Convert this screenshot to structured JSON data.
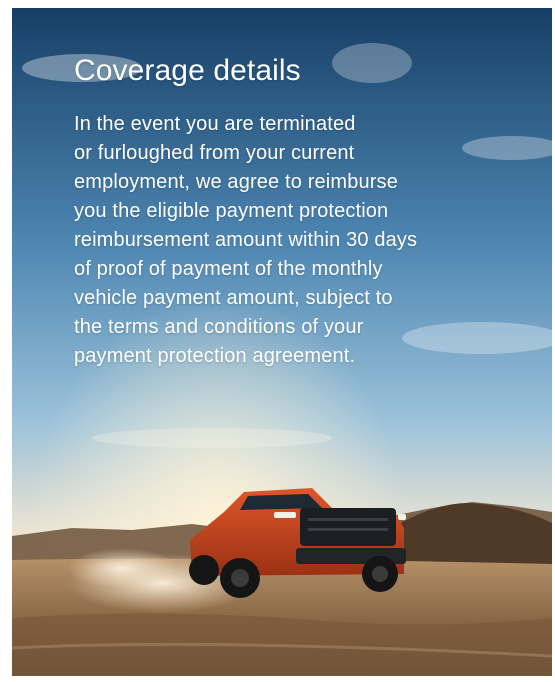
{
  "coverage": {
    "title": "Coverage details",
    "body_lines": [
      "In the event you are terminated",
      "or furloughed from your current",
      "employment, we agree to reimburse",
      "you the eligible payment protection",
      "reimbursement amount within 30 days",
      "of proof of payment of the monthly",
      "vehicle payment amount, subject to",
      "the terms and conditions of your",
      "payment protection agreement."
    ]
  },
  "colors": {
    "text": "#ffffff",
    "sky_top": "#1d4f7c",
    "sky_mid": "#6fa2c6",
    "horizon": "#f3e1c2",
    "ground": "#8a6846",
    "truck": "#c2421c"
  },
  "image": {
    "subject": "red pickup truck driving on desert dirt road"
  }
}
